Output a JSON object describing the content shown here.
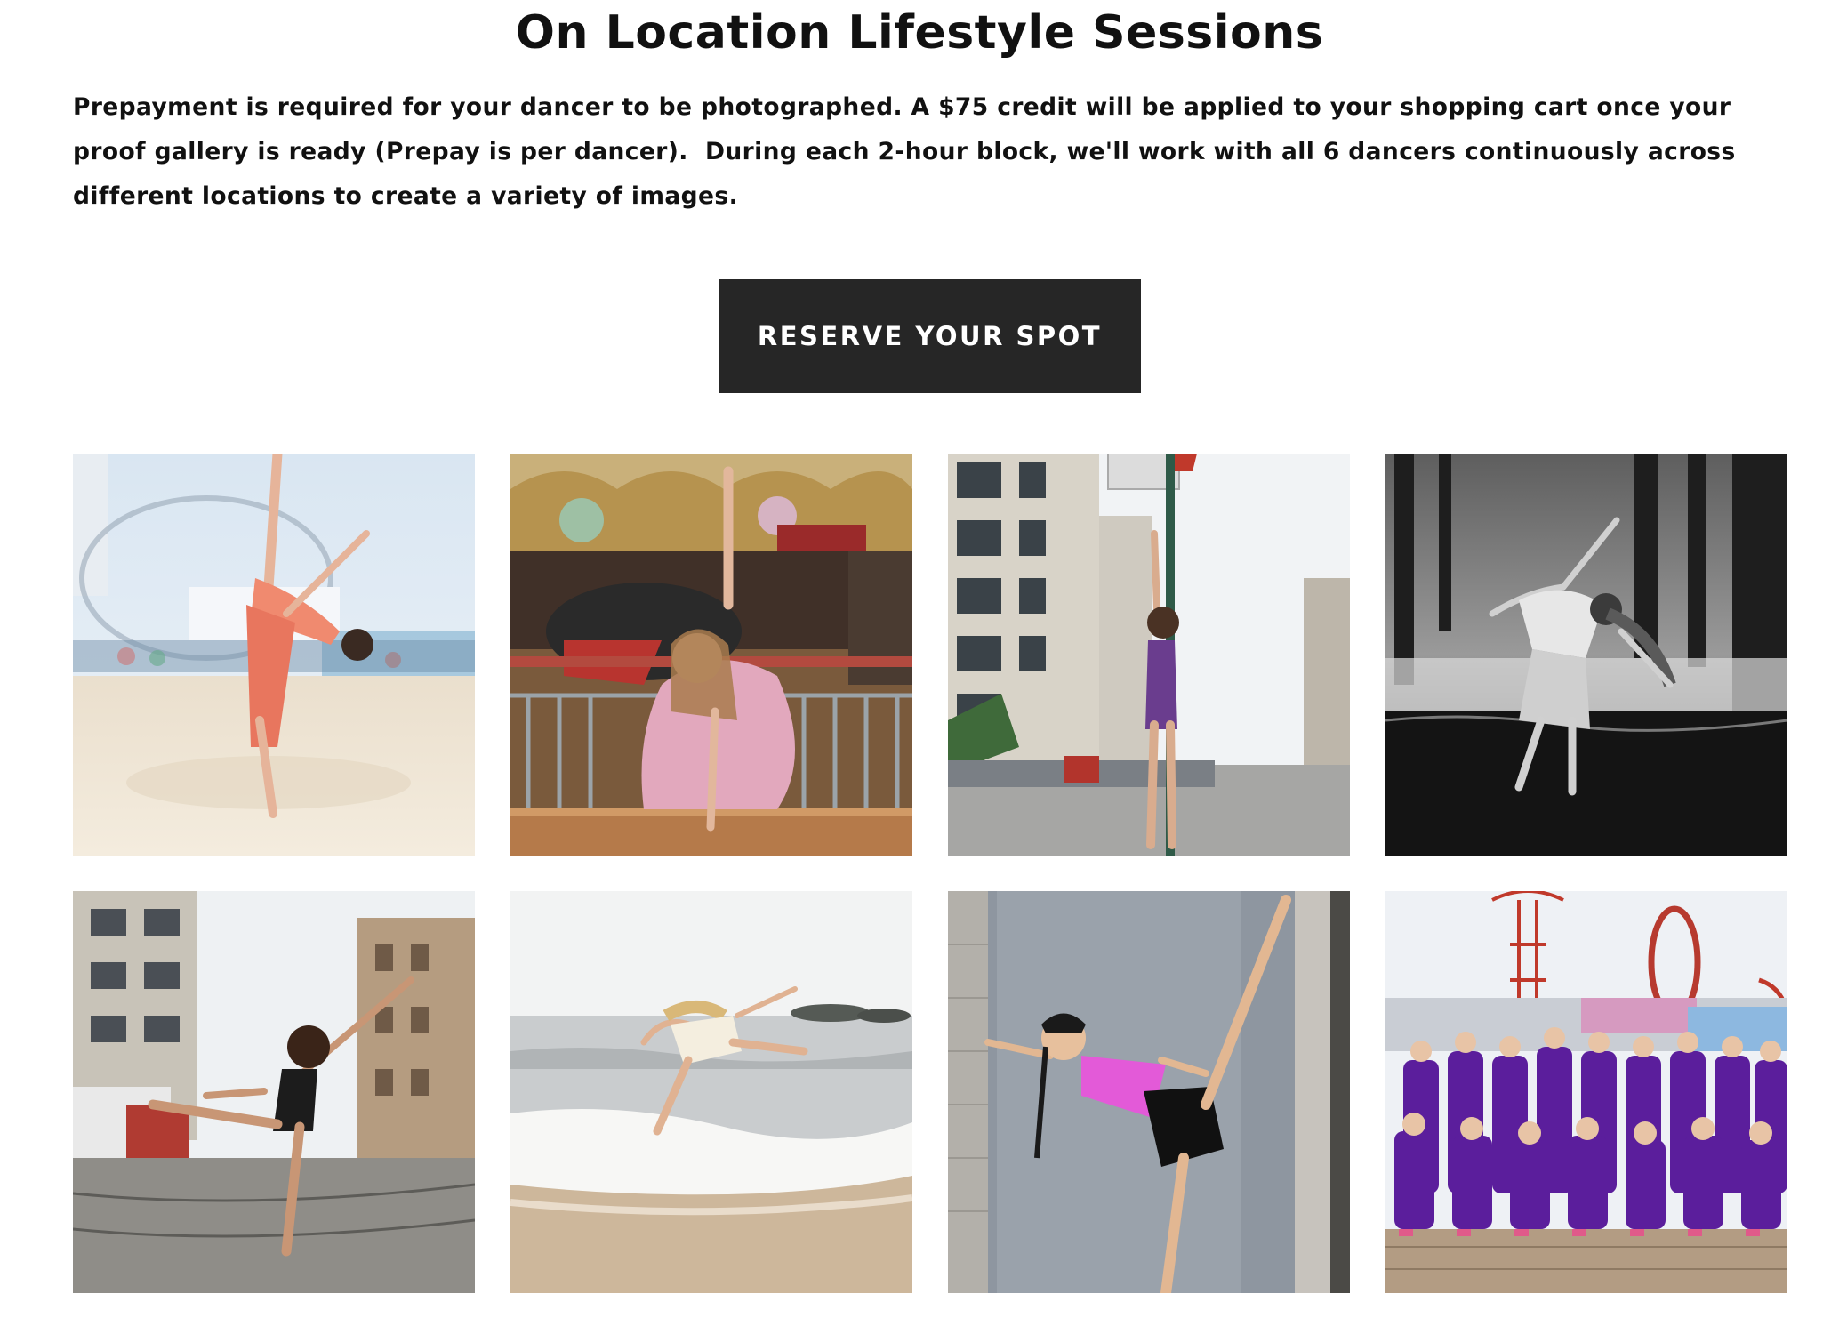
{
  "page": {
    "title": "On Location Lifestyle Sessions",
    "intro": "Prepayment is required for your dancer to be photographed. A $75 credit will be applied to your shopping cart once your proof gallery is ready (Prepay is per dancer).  During each 2-hour block, we'll work with all 6 dancers continuously across different locations to create a variety of images."
  },
  "cta": {
    "label": "RESERVE YOUR SPOT",
    "background": "#262626",
    "text_color": "#ffffff"
  },
  "gallery": {
    "photos": [
      {
        "scene": "dancer in coral dress on beach",
        "icon": "photo-beach-arabesque"
      },
      {
        "scene": "dancer in pink tutu at carousel",
        "icon": "photo-carousel-tutu"
      },
      {
        "scene": "dancer in purple leotard by street sign",
        "icon": "photo-street-pole"
      },
      {
        "scene": "black and white dancer under pier",
        "icon": "photo-pier-bw"
      },
      {
        "scene": "dancer in black leotard on cobblestone street",
        "icon": "photo-street-arabesque"
      },
      {
        "scene": "dancer leaping at shoreline",
        "icon": "photo-shore-leap"
      },
      {
        "scene": "dancer in pink top against gray door",
        "icon": "photo-door-kick"
      },
      {
        "scene": "dance team in purple on boardwalk",
        "icon": "photo-team-boardwalk"
      }
    ]
  }
}
